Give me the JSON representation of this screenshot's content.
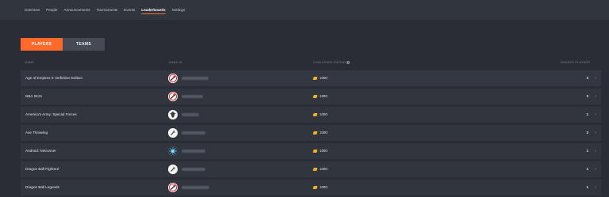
{
  "nav": {
    "tabs": [
      "Overview",
      "People",
      "Announcements",
      "Tournaments",
      "Events",
      "Leaderboards",
      "Settings"
    ],
    "active": "Leaderboards"
  },
  "toggle": {
    "players": "PLAYERS",
    "teams": "TEAMS"
  },
  "table": {
    "headers": {
      "game": "Game",
      "rank": "Rank #1",
      "rating": "Challenge Rating",
      "ranked": "Ranked Players"
    },
    "rows": [
      {
        "game": "Age of Empires II: Definitive Edition",
        "avatar": "red-slash",
        "rating": "1000",
        "count": "3"
      },
      {
        "game": "NBA 2K21",
        "avatar": "red-slash",
        "rating": "1000",
        "count": "3"
      },
      {
        "game": "America's Army: Special Forces",
        "avatar": "emblem",
        "rating": "1000",
        "count": "1"
      },
      {
        "game": "Axe Throwing",
        "avatar": "gray-arrow",
        "rating": "1000",
        "count": "2"
      },
      {
        "game": "Android: Netrunner",
        "avatar": "blue-burst",
        "rating": "1000",
        "count": "1"
      },
      {
        "game": "Dragon Ball FighterZ",
        "avatar": "gray-arrow",
        "rating": "1000",
        "count": "1"
      },
      {
        "game": "Dragon Ball Legends",
        "avatar": "red-slash",
        "rating": "1000",
        "count": "1"
      }
    ]
  },
  "colors": {
    "accent": "#ff6a2a",
    "coin": "#f2b120",
    "background": "#2a2d35",
    "row": "#31353e"
  }
}
